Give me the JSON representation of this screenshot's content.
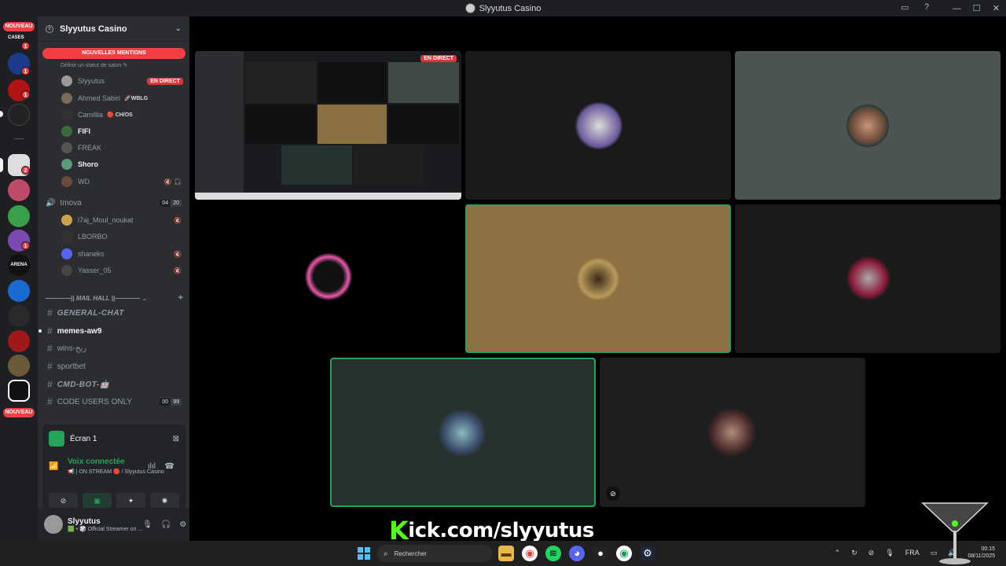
{
  "window": {
    "title": "Slyyutus Casino",
    "controls": [
      "—",
      "☐",
      "✕"
    ]
  },
  "rail": {
    "new_badge_top": "NOUVEAU",
    "new_badge_bottom": "NOUVEAU",
    "cases_label": "CASES",
    "badges": [
      "1",
      "1",
      "1",
      "2",
      "2",
      "1"
    ],
    "arena_label": "ARENA"
  },
  "server": {
    "name": "Slyyutus Casino",
    "boost_count": "0",
    "mentions_pill": "NOUVELLES MENTIONS",
    "status_hint": "Définir un statut de salon ✎"
  },
  "live_channel_members": [
    {
      "name": "Slyyutus",
      "badge": "EN DIRECT",
      "color": "#9a9a9a"
    },
    {
      "name": "Ahmed Sabiri",
      "tag": "🚀WBLG",
      "color": "#7a6b5a"
    },
    {
      "name": "Camillia",
      "tag": "🔴 CH/OS",
      "color": "#333"
    },
    {
      "name": "FIFI",
      "color": "#3a6b3a"
    },
    {
      "name": "FREAK",
      "color": "#555"
    },
    {
      "name": "Shoro",
      "color": "#5a9a7a"
    },
    {
      "name": "WD",
      "color": "#6a4a3a",
      "muted": "🔇 🎧"
    }
  ],
  "voice_channel": {
    "name": "tmova",
    "count_a": "04",
    "count_b": "20",
    "members": [
      {
        "name": "l7aj_Moul_noukat",
        "color": "#c9a44a",
        "muted": "🔇"
      },
      {
        "name": "LBORBO",
        "color": "#333"
      },
      {
        "name": "shaneks",
        "color": "#5865f2",
        "muted": "🔇"
      },
      {
        "name": "Yasser_05",
        "color": "#444",
        "muted": "🔇"
      }
    ]
  },
  "category": {
    "label": "————|| MAIL HALL ||———— ⌄",
    "plus": "+"
  },
  "text_channels": [
    {
      "name": "GENERAL-CHAT",
      "style": "italic"
    },
    {
      "name": "memes-aw9",
      "style": "active"
    },
    {
      "name": "wins-ربح",
      "style": "normal"
    },
    {
      "name": "sportbet",
      "style": "normal"
    },
    {
      "name": "CMD-BOT-🤖",
      "style": "italic"
    },
    {
      "name": "CODE USERS ONLY",
      "style": "normal",
      "count_a": "00",
      "count_b": "99"
    }
  ],
  "stream_panel": {
    "screen_label": "Écran 1",
    "voice_status": "Voix connectée",
    "voice_sub": "📢 | ON STREAM 🔴 / Slyyutus Casino",
    "controls": [
      "⊘",
      "▣",
      "✦",
      "✺"
    ]
  },
  "user": {
    "name": "Slyyutus",
    "status": "🟩 • 🎲 Official Streamer on ..."
  },
  "stage": {
    "live_badge": "EN DIRECT"
  },
  "overlay": {
    "kick_k": "K",
    "kick_rest": "ick.com/slyyutus"
  },
  "taskbar": {
    "search_placeholder": "Rechercher",
    "language": "FRA",
    "time": "00:15",
    "date": "08/11/2025"
  },
  "colors": {
    "accent_green": "#23a55a",
    "live_red": "#da373c",
    "kick_green": "#53fc18"
  }
}
